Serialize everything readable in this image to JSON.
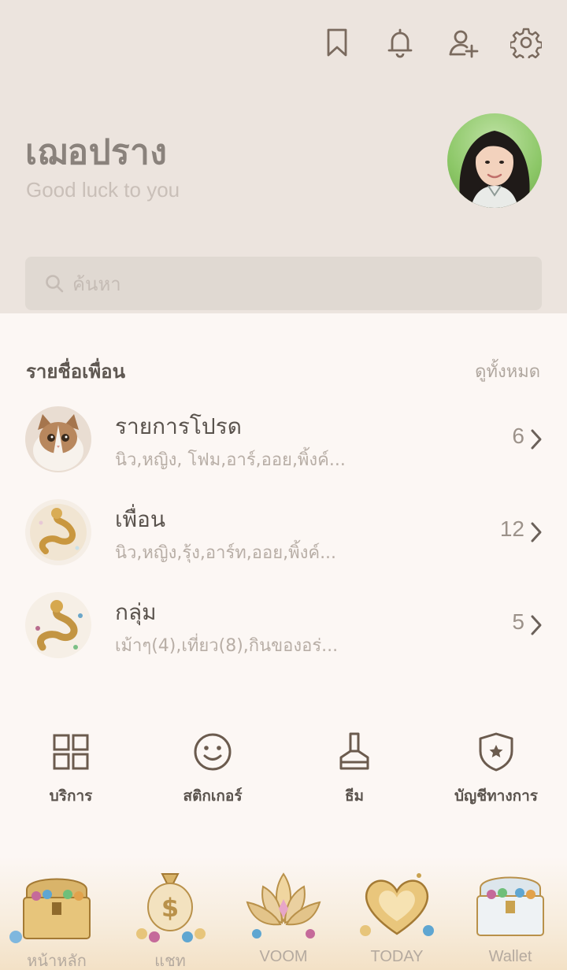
{
  "top_icons": [
    "bookmark-icon",
    "bell-icon",
    "add-friend-icon",
    "gear-icon"
  ],
  "profile": {
    "name": "เฌอปราง",
    "status": "Good luck to you"
  },
  "search": {
    "placeholder": "ค้นหา"
  },
  "friends_section": {
    "title": "รายชื่อเพื่อน",
    "see_all": "ดูทั้งหมด",
    "rows": [
      {
        "title": "รายการโปรด",
        "subtitle": "นิว,หญิง, โฟม,อาร์,ออย,พิ้งค์...",
        "count": "6"
      },
      {
        "title": "เพื่อน",
        "subtitle": "นิว,หญิง,รุ้ง,อาร์ท,ออย,พิ้งค์...",
        "count": "12"
      },
      {
        "title": "กลุ่ม",
        "subtitle": "เม้าๆ(4),เที่ยว(8),กินของอร่...",
        "count": "5"
      }
    ]
  },
  "services": [
    {
      "label": "บริการ",
      "icon": "grid-icon"
    },
    {
      "label": "สติกเกอร์",
      "icon": "smiley-icon"
    },
    {
      "label": "ธีม",
      "icon": "brush-icon"
    },
    {
      "label": "บัญชีทางการ",
      "icon": "shield-star-icon"
    }
  ],
  "tabs": [
    {
      "label": "หน้าหลัก",
      "icon": "treasure-chest-icon"
    },
    {
      "label": "แชท",
      "icon": "money-bag-icon"
    },
    {
      "label": "VOOM",
      "icon": "lotus-icon"
    },
    {
      "label": "TODAY",
      "icon": "gold-heart-icon"
    },
    {
      "label": "Wallet",
      "icon": "jewel-chest-icon"
    }
  ],
  "colors": {
    "header_bg": "#ece4de",
    "body_bg": "#fcf7f4",
    "icon": "#7a6a5e",
    "accent_gold": "#d8b46a"
  }
}
